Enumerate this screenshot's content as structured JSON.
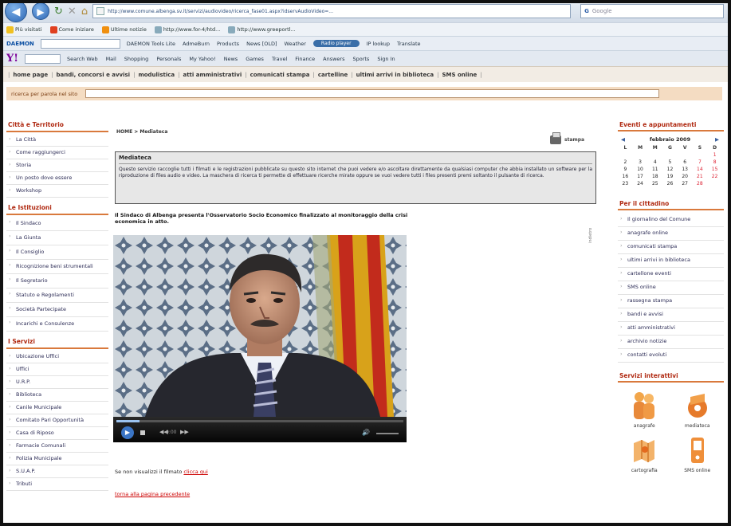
{
  "browser": {
    "address": "http://www.comune.albenga.sv.it/servizi/audiovideo/ricerca_fase01.aspx?idservAudioVideo=...",
    "web_search_placeholder": "Google"
  },
  "bookmarks": [
    {
      "label": "Più visitati",
      "color": "#f0c020"
    },
    {
      "label": "Come iniziare",
      "color": "#e04020"
    },
    {
      "label": "Ultime notizie",
      "color": "#f09010"
    },
    {
      "label": "http://www.for-4/htd...",
      "color": "#8ab"
    },
    {
      "label": "http://www.greeportl...",
      "color": "#8ab"
    }
  ],
  "toolbar": {
    "logo": "DAEMON",
    "items": [
      "DAEMON Tools Lite",
      "AdmeBurn",
      "Products",
      "News [OLD]",
      "Weather",
      "Radio player",
      "IP lookup",
      "Translate"
    ],
    "pill": "Radio player"
  },
  "yahoo_bar": {
    "logo": "Y!",
    "items": [
      "Search Web",
      "Mail",
      "Shopping",
      "Personals",
      "My Yahoo!",
      "News",
      "Games",
      "Travel",
      "Finance",
      "Answers",
      "Sports",
      "Sign In"
    ]
  },
  "site_links": [
    "home page",
    "bandi, concorsi e avvisi",
    "modulistica",
    "atti amministrativi",
    "comunicati stampa",
    "cartelline",
    "ultimi arrivi in biblioteca",
    "SMS online"
  ],
  "search_strip": {
    "label": "ricerca per parola nel sito"
  },
  "sidebar_left": [
    {
      "title": "Città e Territorio",
      "items": [
        "La Città",
        "Come raggiungerci",
        "Storia",
        "Un posto dove essere",
        "Workshop"
      ]
    },
    {
      "title": "Le Istituzioni",
      "items": [
        "Il Sindaco",
        "La Giunta",
        "Il Consiglio",
        "Ricognizione beni strumentali",
        "Il Segretario",
        "Statuto e Regolamenti",
        "Società Partecipate",
        "Incarichi e Consulenze"
      ]
    },
    {
      "title": "I Servizi",
      "items": [
        "Ubicazione Uffici",
        "Uffici",
        "U.R.P.",
        "Biblioteca",
        "Canile Municipale",
        "Comitato Pari Opportunità",
        "Casa di Riposo",
        "Farmacie Comunali",
        "Polizia Municipale",
        "S.U.A.P.",
        "Tributi"
      ]
    }
  ],
  "main": {
    "breadcrumb": "HOME > Mediateca",
    "print_label": "stampa",
    "box_title": "Mediateca",
    "box_text": "Questo servizio raccoglie tutti i filmati e le registrazioni pubblicate su questo sito internet che puoi vedere e/o ascoltare direttamente da qualsiasi computer che abbia installato un software per la riproduzione di files audio e video. La maschera di ricerca ti permette di effettuare ricerche mirate oppure se vuoi vedere tutti i files presenti premi soltanto il pulsante di ricerca.",
    "article_lead": "Il Sindaco di Albenga presenta l'Osservatorio Socio Economico finalizzato al monitoraggio della crisi economica in atto.",
    "vertical_label": "indietro",
    "video": {
      "time": "0:00",
      "progress": 0.08
    },
    "fallback_prefix": "Se non visualizzi il filmato",
    "fallback_link": "clicca qui",
    "back_link": "torna alla pagina precedente"
  },
  "sidebar_right": {
    "events_title": "Eventi e appuntamenti",
    "calendar": {
      "month": "febbraio 2009",
      "weekdays": [
        "L",
        "M",
        "M",
        "G",
        "V",
        "S",
        "D"
      ],
      "weeks": [
        [
          "",
          "",
          "",
          "",
          "",
          "",
          "1"
        ],
        [
          "2",
          "3",
          "4",
          "5",
          "6",
          "7",
          "8"
        ],
        [
          "9",
          "10",
          "11",
          "12",
          "13",
          "14",
          "15"
        ],
        [
          "16",
          "17",
          "18",
          "19",
          "20",
          "21",
          "22"
        ],
        [
          "23",
          "24",
          "25",
          "26",
          "27",
          "28",
          ""
        ]
      ]
    },
    "citizen_title": "Per il cittadino",
    "citizen_items": [
      "Il giornalino del Comune",
      "anagrafe online",
      "comunicati stampa",
      "ultimi arrivi in biblioteca",
      "cartellone eventi",
      "SMS online",
      "rassegna stampa",
      "bandi e avvisi",
      "atti amministrativi",
      "archivio notizie",
      "contatti evoluti"
    ],
    "services_title": "Servizi interattivi",
    "services": [
      "anagrafe",
      "mediateca",
      "cartografia",
      "SMS online"
    ]
  }
}
